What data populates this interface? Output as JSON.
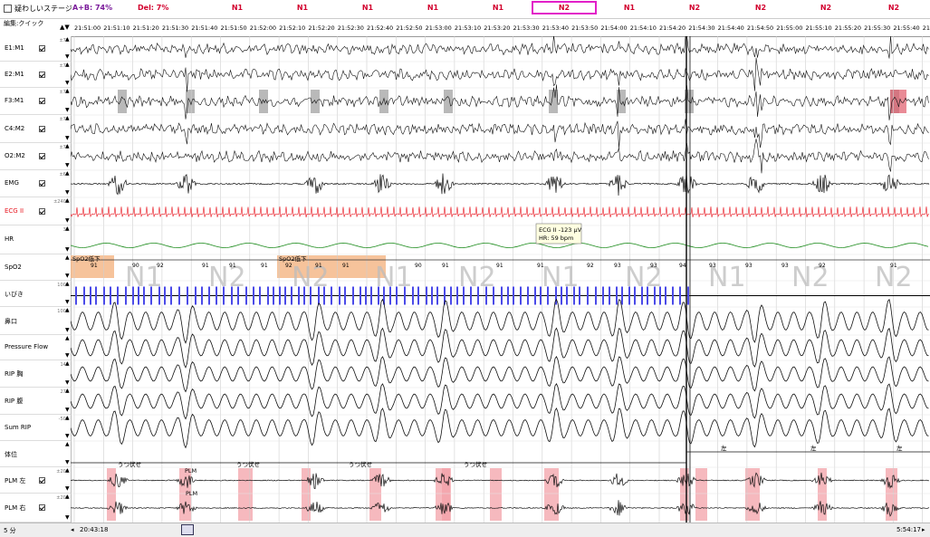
{
  "stagebar": {
    "checkbox_label": "疑わしいステージ",
    "ab_label": "A+B: 74%",
    "del_label": "Del: 7%",
    "stages": [
      "N1",
      "N1",
      "N1",
      "N1",
      "N1",
      "N2",
      "N1",
      "N2",
      "N2",
      "N2",
      "N2"
    ],
    "selected_stage_index": 5
  },
  "editmode": "編集:クイック",
  "time_labels": [
    "21:51:00",
    "21:51:10",
    "21:51:20",
    "21:51:30",
    "21:51:40",
    "21:51:50",
    "21:52:00",
    "21:52:10",
    "21:52:20",
    "21:52:30",
    "21:52:40",
    "21:52:50",
    "21:53:00",
    "21:53:10",
    "21:53:20",
    "21:53:30",
    "21:53:40",
    "21:53:50",
    "21:54:00",
    "21:54:10",
    "21:54:20",
    "21:54:30",
    "21:54:40",
    "21:54:50",
    "21:55:00",
    "21:55:10",
    "21:55:20",
    "21:55:30",
    "21:55:40",
    "21:55:50"
  ],
  "channels": [
    {
      "name": "E1:M1",
      "scale": "±70"
    },
    {
      "name": "E2:M1",
      "scale": "±70"
    },
    {
      "name": "F3:M1",
      "scale": "±70"
    },
    {
      "name": "C4:M2",
      "scale": "±70"
    },
    {
      "name": "O2:M2",
      "scale": "±70"
    },
    {
      "name": "EMG",
      "scale": "±60"
    },
    {
      "name": "ECG II",
      "scale": "±2400"
    },
    {
      "name": "HR",
      "scale": "38"
    },
    {
      "name": "SpO2",
      "scale": ""
    },
    {
      "name": "いびき",
      "scale": "1000"
    },
    {
      "name": "鼻口",
      "scale": "1000"
    },
    {
      "name": "Pressure Flow",
      "scale": ""
    },
    {
      "name": "RIP 胸",
      "scale": "148"
    },
    {
      "name": "RIP 腹",
      "scale": "270"
    },
    {
      "name": "Sum RIP",
      "scale": "-500"
    },
    {
      "name": "体位",
      "scale": ""
    },
    {
      "name": "PLM 左",
      "scale": "±200"
    },
    {
      "name": "PLM 右",
      "scale": "±200"
    }
  ],
  "tooltip": {
    "line1": "ECG II -123 μV",
    "line2": "HR: 59 bpm"
  },
  "spo2_events": [
    "SpO2低下",
    "SpO2低下"
  ],
  "spo2_values": [
    "91",
    "90",
    "92",
    "91",
    "91",
    "91",
    "92",
    "91",
    "91",
    "90",
    "91",
    "91",
    "91",
    "92",
    "93",
    "93",
    "94",
    "93",
    "93",
    "93",
    "92",
    "91"
  ],
  "watermark": [
    "N1",
    "N2",
    "N2",
    "N1",
    "N2",
    "N1",
    "N2",
    "N1",
    "N2",
    "N2"
  ],
  "position_labels": [
    "うつ伏せ",
    "うつ伏せ",
    "うつ伏せ",
    "うつ伏せ",
    "左",
    "左",
    "左"
  ],
  "plm_labels": [
    "PLM",
    "PLM",
    "PLM"
  ],
  "bottombar": {
    "epoch": "5 分",
    "start_time": "20:43:18",
    "end_time": "5:54:17"
  },
  "colors": {
    "stage": "#d2002d",
    "selection": "#e21ec8",
    "ecg": "#e8141e",
    "hr": "#1a8a1a",
    "snore": "#4a4ae8",
    "spo2event": "#f5b98a",
    "plm": "#f3a2a8",
    "arousal": "#7f7f7f"
  }
}
